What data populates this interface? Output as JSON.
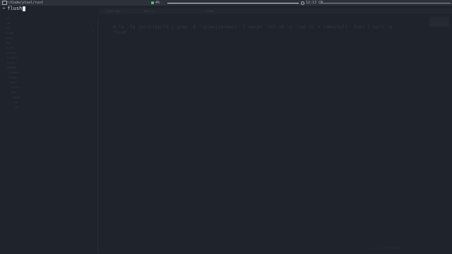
{
  "topbar": {
    "title": "~/Code/ytsel/rust",
    "battery": "4%",
    "clock": "12:13 CB",
    "progress": 1.0
  },
  "prompt": {
    "arrow": "➜",
    "command": "flush"
  },
  "ghost": {
    "tabs": [
      "cargo.toml",
      "main.rs",
      "readme"
    ],
    "tree": [
      "src",
      "lib",
      "bin",
      "target",
      "tests",
      "docs",
      "assets",
      "config",
      "scripts",
      "build",
      "README",
      "LICENSE",
      "Cargo",
      "main",
      "utils",
      "mod",
      "cache",
      "cli",
      "run"
    ],
    "code": [
      "    # ls -la /proc/$$/fd | grep -E '(pipe|socket)' | xargs -I{} sh -c 'cat {} > /dev/null' 2>&1 | sort -u",
      "       flush"
    ],
    "status": "Ln 1, Col 1   UTF-8   Rust"
  },
  "colors": {
    "background": "#1f232b",
    "topbar": "#2c313a",
    "battery": "#4fbf7f",
    "prompt_arrow": "#6a9fd4"
  }
}
